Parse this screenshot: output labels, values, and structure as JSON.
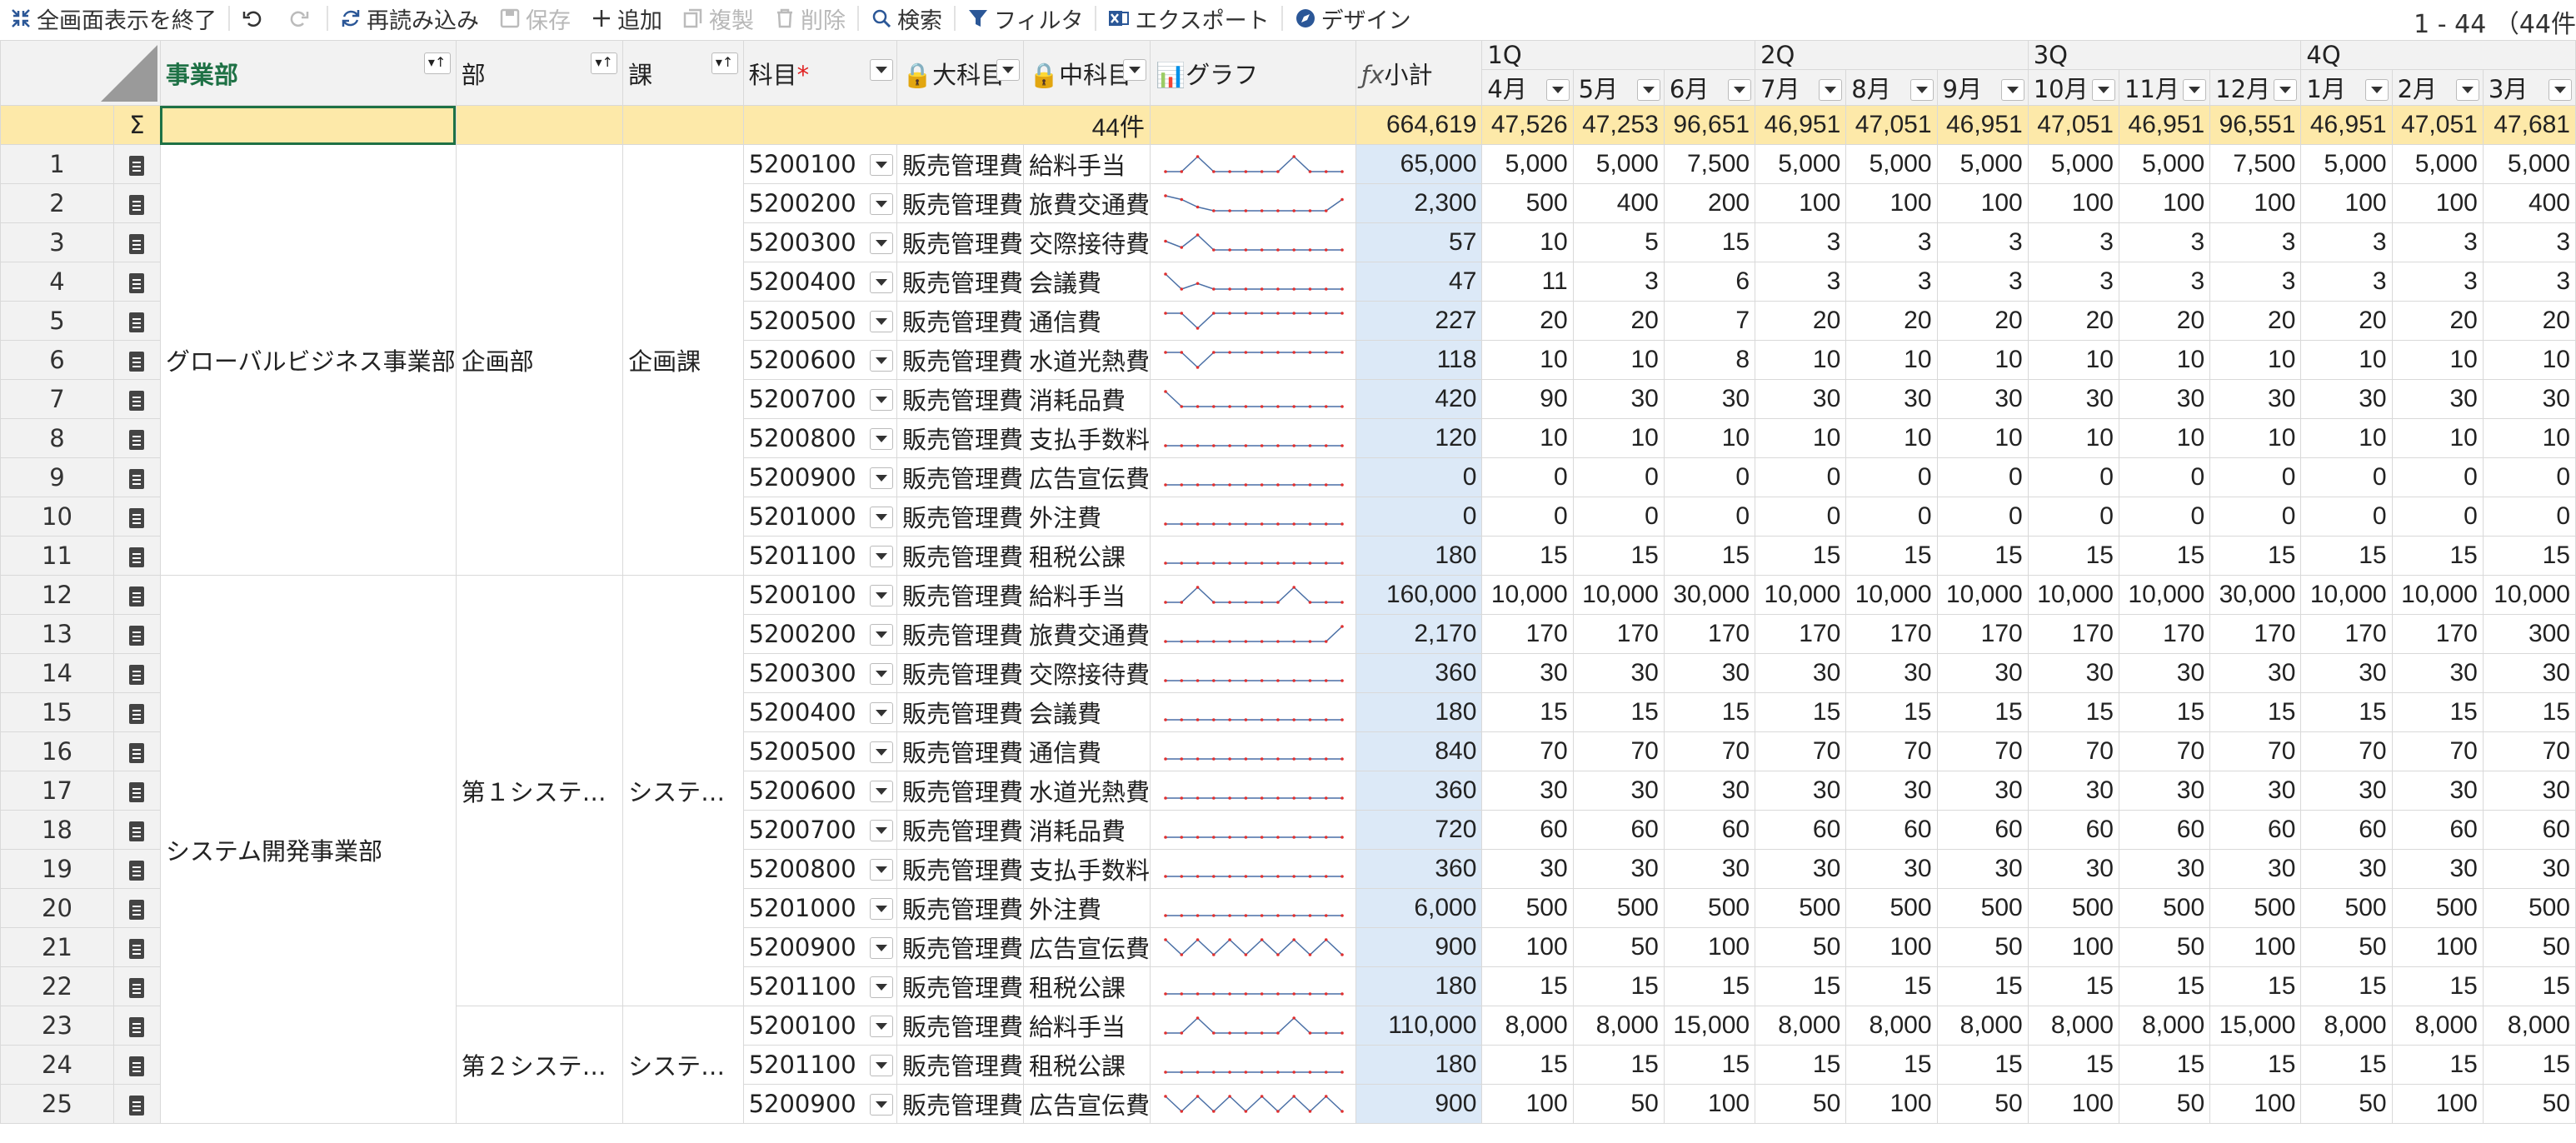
{
  "toolbar": {
    "exit_fullscreen": "全画面表示を終了",
    "reload": "再読み込み",
    "save": "保存",
    "add": "追加",
    "copy": "複製",
    "delete": "削除",
    "search": "検索",
    "filter": "フィルタ",
    "export": "エクスポート",
    "design": "デザイン",
    "range_info": "1 - 44 （44件"
  },
  "headers": {
    "sum_symbol": "Σ",
    "division": "事業部",
    "dept": "部",
    "section": "課",
    "account": "科目",
    "required_mark": "*",
    "major": "大科目",
    "middle": "中科目",
    "graph": "グラフ",
    "subtotal": "小計",
    "quarters": [
      "1Q",
      "2Q",
      "3Q",
      "4Q"
    ],
    "months": [
      "4月",
      "5月",
      "6月",
      "7月",
      "8月",
      "9月",
      "10月",
      "11月",
      "12月",
      "1月",
      "2月",
      "3月"
    ]
  },
  "summary": {
    "count": "44件",
    "subtotal": "664,619",
    "months": [
      "47,526",
      "47,253",
      "96,651",
      "46,951",
      "47,051",
      "46,951",
      "47,051",
      "46,951",
      "96,551",
      "46,951",
      "47,051",
      "47,681"
    ]
  },
  "groups": {
    "g1": {
      "division": "グローバルビジネス事業部",
      "dept": "企画部",
      "section": "企画課"
    },
    "g2": {
      "division": "システム開発事業部",
      "dept": "第１システ…",
      "section": "システ…"
    },
    "g3": {
      "dept": "第２システ…",
      "section": "システ…"
    }
  },
  "rows": [
    {
      "no": "1",
      "account": "5200100",
      "major": "販売管理費",
      "middle": "給料手当",
      "subtotal": "65,000",
      "m": [
        "5,000",
        "5,000",
        "7,500",
        "5,000",
        "5,000",
        "5,000",
        "5,000",
        "5,000",
        "7,500",
        "5,000",
        "5,000",
        "5,000"
      ]
    },
    {
      "no": "2",
      "account": "5200200",
      "major": "販売管理費",
      "middle": "旅費交通費",
      "subtotal": "2,300",
      "m": [
        "500",
        "400",
        "200",
        "100",
        "100",
        "100",
        "100",
        "100",
        "100",
        "100",
        "100",
        "400"
      ]
    },
    {
      "no": "3",
      "account": "5200300",
      "major": "販売管理費",
      "middle": "交際接待費",
      "subtotal": "57",
      "m": [
        "10",
        "5",
        "15",
        "3",
        "3",
        "3",
        "3",
        "3",
        "3",
        "3",
        "3",
        "3"
      ]
    },
    {
      "no": "4",
      "account": "5200400",
      "major": "販売管理費",
      "middle": "会議費",
      "subtotal": "47",
      "m": [
        "11",
        "3",
        "6",
        "3",
        "3",
        "3",
        "3",
        "3",
        "3",
        "3",
        "3",
        "3"
      ]
    },
    {
      "no": "5",
      "account": "5200500",
      "major": "販売管理費",
      "middle": "通信費",
      "subtotal": "227",
      "m": [
        "20",
        "20",
        "7",
        "20",
        "20",
        "20",
        "20",
        "20",
        "20",
        "20",
        "20",
        "20"
      ]
    },
    {
      "no": "6",
      "account": "5200600",
      "major": "販売管理費",
      "middle": "水道光熱費",
      "subtotal": "118",
      "m": [
        "10",
        "10",
        "8",
        "10",
        "10",
        "10",
        "10",
        "10",
        "10",
        "10",
        "10",
        "10"
      ]
    },
    {
      "no": "7",
      "account": "5200700",
      "major": "販売管理費",
      "middle": "消耗品費",
      "subtotal": "420",
      "m": [
        "90",
        "30",
        "30",
        "30",
        "30",
        "30",
        "30",
        "30",
        "30",
        "30",
        "30",
        "30"
      ]
    },
    {
      "no": "8",
      "account": "5200800",
      "major": "販売管理費",
      "middle": "支払手数料",
      "subtotal": "120",
      "m": [
        "10",
        "10",
        "10",
        "10",
        "10",
        "10",
        "10",
        "10",
        "10",
        "10",
        "10",
        "10"
      ]
    },
    {
      "no": "9",
      "account": "5200900",
      "major": "販売管理費",
      "middle": "広告宣伝費",
      "subtotal": "0",
      "m": [
        "0",
        "0",
        "0",
        "0",
        "0",
        "0",
        "0",
        "0",
        "0",
        "0",
        "0",
        "0"
      ]
    },
    {
      "no": "10",
      "account": "5201000",
      "major": "販売管理費",
      "middle": "外注費",
      "subtotal": "0",
      "m": [
        "0",
        "0",
        "0",
        "0",
        "0",
        "0",
        "0",
        "0",
        "0",
        "0",
        "0",
        "0"
      ]
    },
    {
      "no": "11",
      "account": "5201100",
      "major": "販売管理費",
      "middle": "租税公課",
      "subtotal": "180",
      "m": [
        "15",
        "15",
        "15",
        "15",
        "15",
        "15",
        "15",
        "15",
        "15",
        "15",
        "15",
        "15"
      ]
    },
    {
      "no": "12",
      "account": "5200100",
      "major": "販売管理費",
      "middle": "給料手当",
      "subtotal": "160,000",
      "m": [
        "10,000",
        "10,000",
        "30,000",
        "10,000",
        "10,000",
        "10,000",
        "10,000",
        "10,000",
        "30,000",
        "10,000",
        "10,000",
        "10,000"
      ]
    },
    {
      "no": "13",
      "account": "5200200",
      "major": "販売管理費",
      "middle": "旅費交通費",
      "subtotal": "2,170",
      "m": [
        "170",
        "170",
        "170",
        "170",
        "170",
        "170",
        "170",
        "170",
        "170",
        "170",
        "170",
        "300"
      ]
    },
    {
      "no": "14",
      "account": "5200300",
      "major": "販売管理費",
      "middle": "交際接待費",
      "subtotal": "360",
      "m": [
        "30",
        "30",
        "30",
        "30",
        "30",
        "30",
        "30",
        "30",
        "30",
        "30",
        "30",
        "30"
      ]
    },
    {
      "no": "15",
      "account": "5200400",
      "major": "販売管理費",
      "middle": "会議費",
      "subtotal": "180",
      "m": [
        "15",
        "15",
        "15",
        "15",
        "15",
        "15",
        "15",
        "15",
        "15",
        "15",
        "15",
        "15"
      ]
    },
    {
      "no": "16",
      "account": "5200500",
      "major": "販売管理費",
      "middle": "通信費",
      "subtotal": "840",
      "m": [
        "70",
        "70",
        "70",
        "70",
        "70",
        "70",
        "70",
        "70",
        "70",
        "70",
        "70",
        "70"
      ]
    },
    {
      "no": "17",
      "account": "5200600",
      "major": "販売管理費",
      "middle": "水道光熱費",
      "subtotal": "360",
      "m": [
        "30",
        "30",
        "30",
        "30",
        "30",
        "30",
        "30",
        "30",
        "30",
        "30",
        "30",
        "30"
      ]
    },
    {
      "no": "18",
      "account": "5200700",
      "major": "販売管理費",
      "middle": "消耗品費",
      "subtotal": "720",
      "m": [
        "60",
        "60",
        "60",
        "60",
        "60",
        "60",
        "60",
        "60",
        "60",
        "60",
        "60",
        "60"
      ]
    },
    {
      "no": "19",
      "account": "5200800",
      "major": "販売管理費",
      "middle": "支払手数料",
      "subtotal": "360",
      "m": [
        "30",
        "30",
        "30",
        "30",
        "30",
        "30",
        "30",
        "30",
        "30",
        "30",
        "30",
        "30"
      ]
    },
    {
      "no": "20",
      "account": "5201000",
      "major": "販売管理費",
      "middle": "外注費",
      "subtotal": "6,000",
      "m": [
        "500",
        "500",
        "500",
        "500",
        "500",
        "500",
        "500",
        "500",
        "500",
        "500",
        "500",
        "500"
      ]
    },
    {
      "no": "21",
      "account": "5200900",
      "major": "販売管理費",
      "middle": "広告宣伝費",
      "subtotal": "900",
      "m": [
        "100",
        "50",
        "100",
        "50",
        "100",
        "50",
        "100",
        "50",
        "100",
        "50",
        "100",
        "50"
      ]
    },
    {
      "no": "22",
      "account": "5201100",
      "major": "販売管理費",
      "middle": "租税公課",
      "subtotal": "180",
      "m": [
        "15",
        "15",
        "15",
        "15",
        "15",
        "15",
        "15",
        "15",
        "15",
        "15",
        "15",
        "15"
      ]
    },
    {
      "no": "23",
      "account": "5200100",
      "major": "販売管理費",
      "middle": "給料手当",
      "subtotal": "110,000",
      "m": [
        "8,000",
        "8,000",
        "15,000",
        "8,000",
        "8,000",
        "8,000",
        "8,000",
        "8,000",
        "15,000",
        "8,000",
        "8,000",
        "8,000"
      ]
    },
    {
      "no": "24",
      "account": "5201100",
      "major": "販売管理費",
      "middle": "租税公課",
      "subtotal": "180",
      "m": [
        "15",
        "15",
        "15",
        "15",
        "15",
        "15",
        "15",
        "15",
        "15",
        "15",
        "15",
        "15"
      ]
    },
    {
      "no": "25",
      "account": "5200900",
      "major": "販売管理費",
      "middle": "広告宣伝費",
      "subtotal": "900",
      "m": [
        "100",
        "50",
        "100",
        "50",
        "100",
        "50",
        "100",
        "50",
        "100",
        "50",
        "100",
        "50"
      ]
    }
  ],
  "colors": {
    "accent": "#1e7145",
    "sum_row": "#fde9a9",
    "subtotal_col": "#dce9f7",
    "spark_line": "#4a6fa5",
    "spark_dot": "#e03030"
  }
}
